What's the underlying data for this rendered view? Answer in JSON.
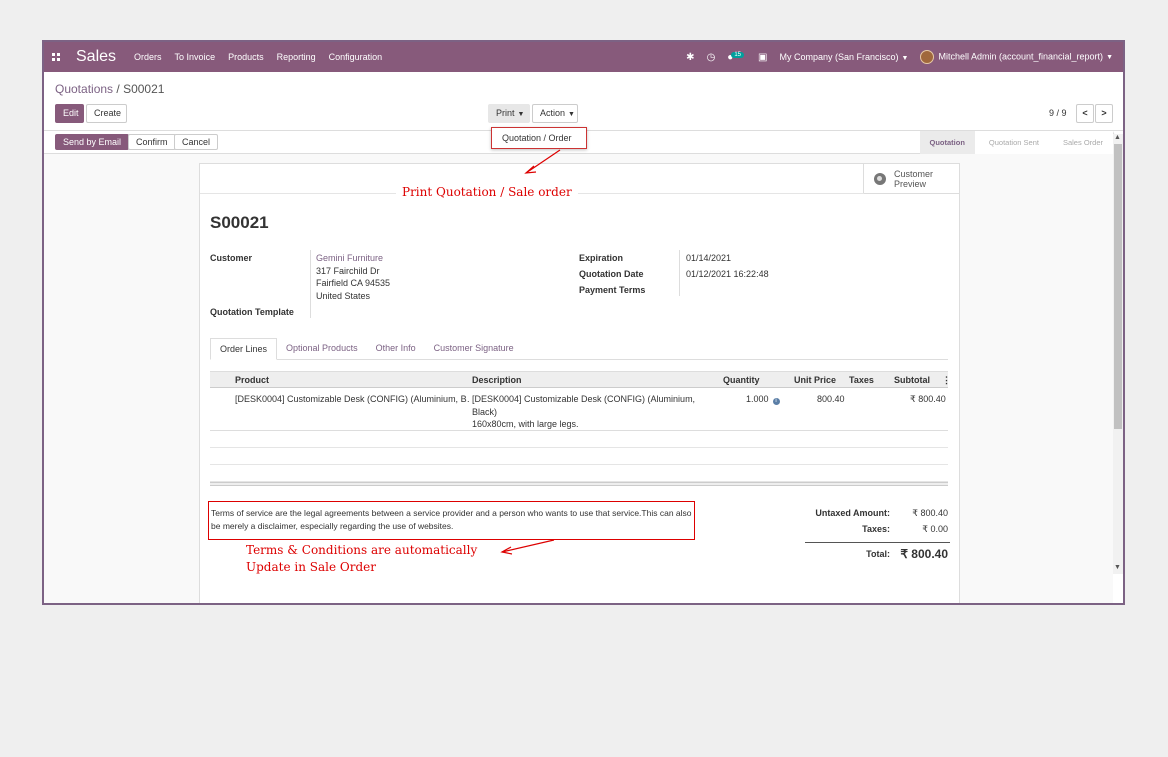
{
  "navbar": {
    "app_name": "Sales",
    "menu": [
      "Orders",
      "To Invoice",
      "Products",
      "Reporting",
      "Configuration"
    ],
    "chat_count": "15",
    "company": "My Company (San Francisco)",
    "user": "Mitchell Admin (account_financial_report)",
    "colors": {
      "primary": "#875a7b"
    }
  },
  "breadcrumb": {
    "parent": "Quotations",
    "separator": "/",
    "current": "S00021"
  },
  "toolbar": {
    "edit_label": "Edit",
    "create_label": "Create",
    "print_label": "Print",
    "action_label": "Action",
    "pager": "9 / 9"
  },
  "print_menu": {
    "items": [
      "Quotation / Order"
    ]
  },
  "statusbar": {
    "send_label": "Send by Email",
    "confirm_label": "Confirm",
    "cancel_label": "Cancel",
    "stages": [
      "Quotation",
      "Quotation Sent",
      "Sales Order"
    ],
    "active_stage": "Quotation"
  },
  "annotations": {
    "print": "Print Quotation / Sale order",
    "terms_line1": "Terms & Conditions are automatically",
    "terms_line2": "Update in Sale Order"
  },
  "sheet": {
    "preview_label_1": "Customer",
    "preview_label_2": "Preview",
    "name": "S00021",
    "customer_label": "Customer",
    "customer_name": "Gemini Furniture",
    "customer_street": "317 Fairchild Dr",
    "customer_city": "Fairfield CA 94535",
    "customer_country": "United States",
    "template_label": "Quotation Template",
    "expiration_label": "Expiration",
    "expiration_value": "01/14/2021",
    "quotation_date_label": "Quotation Date",
    "quotation_date_value": "01/12/2021 16:22:48",
    "payment_terms_label": "Payment Terms"
  },
  "tabs": [
    "Order Lines",
    "Optional Products",
    "Other Info",
    "Customer Signature"
  ],
  "lines": {
    "headers": [
      "Product",
      "Description",
      "Quantity",
      "Unit Price",
      "Taxes",
      "Subtotal"
    ],
    "rows": [
      {
        "product": "[DESK0004] Customizable Desk (CONFIG) (Aluminium, B…",
        "desc1": "[DESK0004] Customizable Desk (CONFIG) (Aluminium,",
        "desc2": "Black)",
        "desc3": "160x80cm, with large legs.",
        "quantity": "1.000",
        "unit_price": "800.40",
        "taxes": "",
        "subtotal": "₹ 800.40"
      }
    ]
  },
  "terms": "Terms of service are the legal agreements between a service provider and a person who wants to use that service.This can also be merely a disclaimer, especially regarding the use of websites.",
  "totals": {
    "untaxed_label": "Untaxed Amount:",
    "untaxed_value": "₹ 800.40",
    "taxes_label": "Taxes:",
    "taxes_value": "₹ 0.00",
    "total_label": "Total:",
    "total_value": "₹ 800.40"
  }
}
